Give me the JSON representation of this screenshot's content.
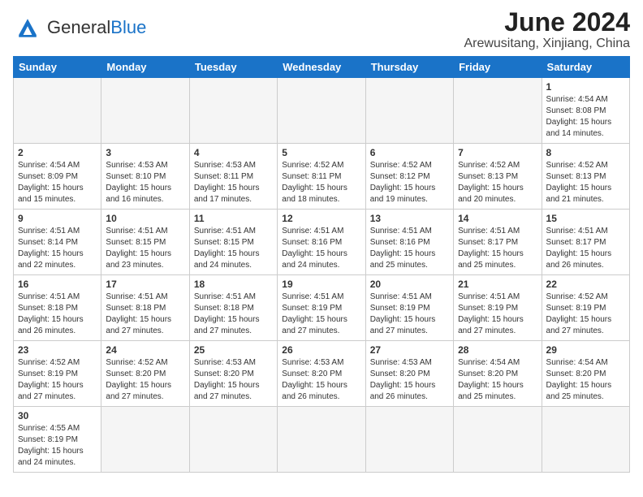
{
  "logo": {
    "text_general": "General",
    "text_blue": "Blue"
  },
  "title": "June 2024",
  "subtitle": "Arewusitang, Xinjiang, China",
  "days_of_week": [
    "Sunday",
    "Monday",
    "Tuesday",
    "Wednesday",
    "Thursday",
    "Friday",
    "Saturday"
  ],
  "weeks": [
    [
      {
        "day": "",
        "info": "",
        "empty": true
      },
      {
        "day": "",
        "info": "",
        "empty": true
      },
      {
        "day": "",
        "info": "",
        "empty": true
      },
      {
        "day": "",
        "info": "",
        "empty": true
      },
      {
        "day": "",
        "info": "",
        "empty": true
      },
      {
        "day": "",
        "info": "",
        "empty": true
      },
      {
        "day": "1",
        "info": "Sunrise: 4:54 AM\nSunset: 8:08 PM\nDaylight: 15 hours and 14 minutes."
      }
    ],
    [
      {
        "day": "2",
        "info": "Sunrise: 4:54 AM\nSunset: 8:09 PM\nDaylight: 15 hours and 15 minutes."
      },
      {
        "day": "3",
        "info": "Sunrise: 4:53 AM\nSunset: 8:10 PM\nDaylight: 15 hours and 16 minutes."
      },
      {
        "day": "4",
        "info": "Sunrise: 4:53 AM\nSunset: 8:11 PM\nDaylight: 15 hours and 17 minutes."
      },
      {
        "day": "5",
        "info": "Sunrise: 4:52 AM\nSunset: 8:11 PM\nDaylight: 15 hours and 18 minutes."
      },
      {
        "day": "6",
        "info": "Sunrise: 4:52 AM\nSunset: 8:12 PM\nDaylight: 15 hours and 19 minutes."
      },
      {
        "day": "7",
        "info": "Sunrise: 4:52 AM\nSunset: 8:13 PM\nDaylight: 15 hours and 20 minutes."
      },
      {
        "day": "8",
        "info": "Sunrise: 4:52 AM\nSunset: 8:13 PM\nDaylight: 15 hours and 21 minutes."
      }
    ],
    [
      {
        "day": "9",
        "info": "Sunrise: 4:51 AM\nSunset: 8:14 PM\nDaylight: 15 hours and 22 minutes."
      },
      {
        "day": "10",
        "info": "Sunrise: 4:51 AM\nSunset: 8:15 PM\nDaylight: 15 hours and 23 minutes."
      },
      {
        "day": "11",
        "info": "Sunrise: 4:51 AM\nSunset: 8:15 PM\nDaylight: 15 hours and 24 minutes."
      },
      {
        "day": "12",
        "info": "Sunrise: 4:51 AM\nSunset: 8:16 PM\nDaylight: 15 hours and 24 minutes."
      },
      {
        "day": "13",
        "info": "Sunrise: 4:51 AM\nSunset: 8:16 PM\nDaylight: 15 hours and 25 minutes."
      },
      {
        "day": "14",
        "info": "Sunrise: 4:51 AM\nSunset: 8:17 PM\nDaylight: 15 hours and 25 minutes."
      },
      {
        "day": "15",
        "info": "Sunrise: 4:51 AM\nSunset: 8:17 PM\nDaylight: 15 hours and 26 minutes."
      }
    ],
    [
      {
        "day": "16",
        "info": "Sunrise: 4:51 AM\nSunset: 8:18 PM\nDaylight: 15 hours and 26 minutes."
      },
      {
        "day": "17",
        "info": "Sunrise: 4:51 AM\nSunset: 8:18 PM\nDaylight: 15 hours and 27 minutes."
      },
      {
        "day": "18",
        "info": "Sunrise: 4:51 AM\nSunset: 8:18 PM\nDaylight: 15 hours and 27 minutes."
      },
      {
        "day": "19",
        "info": "Sunrise: 4:51 AM\nSunset: 8:19 PM\nDaylight: 15 hours and 27 minutes."
      },
      {
        "day": "20",
        "info": "Sunrise: 4:51 AM\nSunset: 8:19 PM\nDaylight: 15 hours and 27 minutes."
      },
      {
        "day": "21",
        "info": "Sunrise: 4:51 AM\nSunset: 8:19 PM\nDaylight: 15 hours and 27 minutes."
      },
      {
        "day": "22",
        "info": "Sunrise: 4:52 AM\nSunset: 8:19 PM\nDaylight: 15 hours and 27 minutes."
      }
    ],
    [
      {
        "day": "23",
        "info": "Sunrise: 4:52 AM\nSunset: 8:19 PM\nDaylight: 15 hours and 27 minutes."
      },
      {
        "day": "24",
        "info": "Sunrise: 4:52 AM\nSunset: 8:20 PM\nDaylight: 15 hours and 27 minutes."
      },
      {
        "day": "25",
        "info": "Sunrise: 4:53 AM\nSunset: 8:20 PM\nDaylight: 15 hours and 27 minutes."
      },
      {
        "day": "26",
        "info": "Sunrise: 4:53 AM\nSunset: 8:20 PM\nDaylight: 15 hours and 26 minutes."
      },
      {
        "day": "27",
        "info": "Sunrise: 4:53 AM\nSunset: 8:20 PM\nDaylight: 15 hours and 26 minutes."
      },
      {
        "day": "28",
        "info": "Sunrise: 4:54 AM\nSunset: 8:20 PM\nDaylight: 15 hours and 25 minutes."
      },
      {
        "day": "29",
        "info": "Sunrise: 4:54 AM\nSunset: 8:20 PM\nDaylight: 15 hours and 25 minutes."
      }
    ],
    [
      {
        "day": "30",
        "info": "Sunrise: 4:55 AM\nSunset: 8:19 PM\nDaylight: 15 hours and 24 minutes."
      },
      {
        "day": "",
        "info": "",
        "empty": true
      },
      {
        "day": "",
        "info": "",
        "empty": true
      },
      {
        "day": "",
        "info": "",
        "empty": true
      },
      {
        "day": "",
        "info": "",
        "empty": true
      },
      {
        "day": "",
        "info": "",
        "empty": true
      },
      {
        "day": "",
        "info": "",
        "empty": true
      }
    ]
  ]
}
